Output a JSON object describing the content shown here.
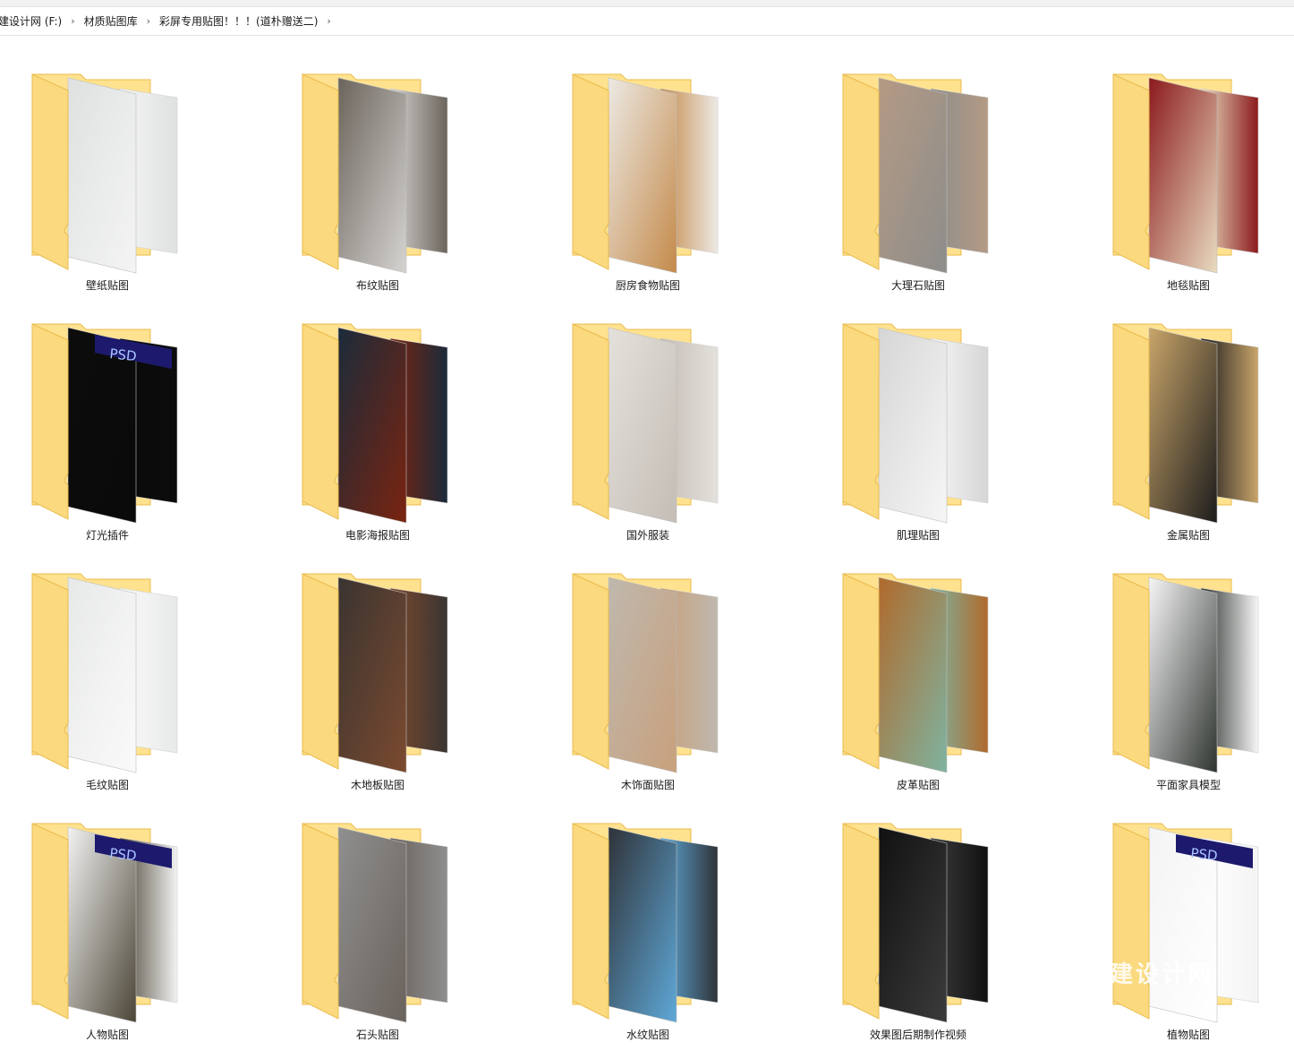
{
  "breadcrumb": [
    "建设计网 (F:)",
    "材质贴图库",
    "彩屏专用贴图！！！(道朴赠送二)"
  ],
  "breadcrumb_separator": "›",
  "folders": [
    {
      "name": "壁纸贴图",
      "thumb": "wallpaper",
      "c": [
        "#dfe1e1",
        "#f4f4f4"
      ]
    },
    {
      "name": "布纹贴图",
      "thumb": "fabric",
      "c": [
        "#6b645c",
        "#d6d4d1"
      ]
    },
    {
      "name": "厨房食物贴图",
      "thumb": "food",
      "c": [
        "#ece9e4",
        "#c48a4a"
      ]
    },
    {
      "name": "大理石贴图",
      "thumb": "marble",
      "c": [
        "#b49a84",
        "#8d8d8b"
      ]
    },
    {
      "name": "地毯贴图",
      "thumb": "carpet",
      "c": [
        "#8b1a1c",
        "#e9dcc0"
      ]
    },
    {
      "name": "灯光插件",
      "thumb": "lights",
      "c": [
        "#0c0c0c",
        "#0a0a0a"
      ],
      "badge": "PSD"
    },
    {
      "name": "电影海报贴图",
      "thumb": "poster",
      "c": [
        "#1b2b3a",
        "#7a2410"
      ]
    },
    {
      "name": "国外服装",
      "thumb": "fashion",
      "c": [
        "#e4e1dc",
        "#c4bdb5"
      ]
    },
    {
      "name": "肌理贴图",
      "thumb": "texture",
      "c": [
        "#d6d6d6",
        "#f6f6f6"
      ]
    },
    {
      "name": "金属贴图",
      "thumb": "metal",
      "c": [
        "#c9a56a",
        "#1c1c1c"
      ]
    },
    {
      "name": "毛纹贴图",
      "thumb": "fur",
      "c": [
        "#e7e9e8",
        "#fafafa"
      ]
    },
    {
      "name": "木地板贴图",
      "thumb": "woodfloor",
      "c": [
        "#3a3431",
        "#7b4a2f"
      ]
    },
    {
      "name": "木饰面贴图",
      "thumb": "woodpanel",
      "c": [
        "#bfb8ae",
        "#c8a07c"
      ]
    },
    {
      "name": "皮革贴图",
      "thumb": "leather",
      "c": [
        "#b06a2c",
        "#7fb3a0"
      ]
    },
    {
      "name": "平面家具模型",
      "thumb": "furniture",
      "c": [
        "#f6f6f6",
        "#2f3430"
      ]
    },
    {
      "name": "人物贴图",
      "thumb": "people",
      "c": [
        "#f2f2f2",
        "#4b4536"
      ],
      "badge": "PSD"
    },
    {
      "name": "石头贴图",
      "thumb": "stone",
      "c": [
        "#8f8f8f",
        "#6a625c"
      ]
    },
    {
      "name": "水纹贴图",
      "thumb": "water",
      "c": [
        "#2f3338",
        "#5fa8d8"
      ]
    },
    {
      "name": "效果图后期制作视频",
      "thumb": "video",
      "c": [
        "#111111",
        "#3b3b3b"
      ]
    },
    {
      "name": "植物贴图",
      "thumb": "plants",
      "c": [
        "#f4f4f4",
        "#ffffff"
      ],
      "badge": "PSD"
    }
  ],
  "watermark_text": "建设计网",
  "colors": {
    "folder_back": "#ffe28f",
    "folder_front": "#fbd97e",
    "folder_edge": "#e9bb4d"
  },
  "icons": [
    "chevron-right-icon",
    "folder-icon"
  ]
}
